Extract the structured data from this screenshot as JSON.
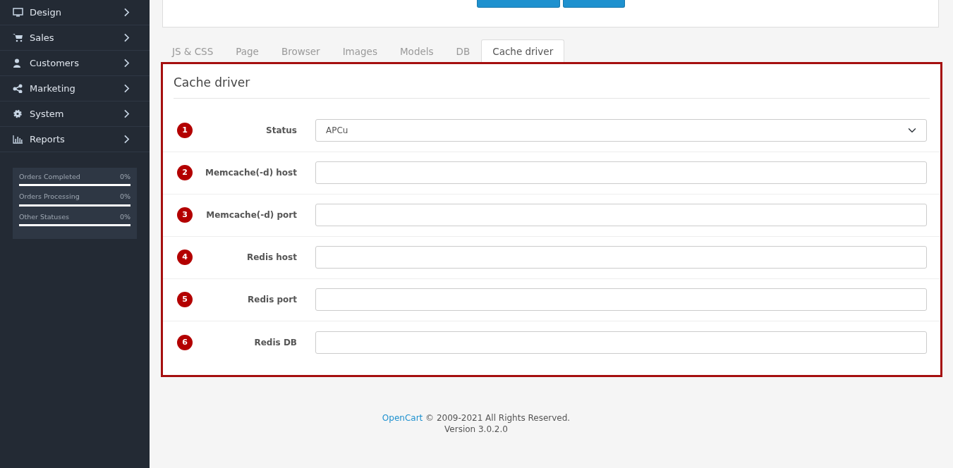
{
  "sidebar": {
    "menu": [
      {
        "label": "Design"
      },
      {
        "label": "Sales"
      },
      {
        "label": "Customers"
      },
      {
        "label": "Marketing"
      },
      {
        "label": "System"
      },
      {
        "label": "Reports"
      }
    ],
    "stats": [
      {
        "label": "Orders Completed",
        "value": "0%"
      },
      {
        "label": "Orders Processing",
        "value": "0%"
      },
      {
        "label": "Other Statuses",
        "value": "0%"
      }
    ]
  },
  "tabs": [
    {
      "label": "JS & CSS",
      "selected": false
    },
    {
      "label": "Page",
      "selected": false
    },
    {
      "label": "Browser",
      "selected": false
    },
    {
      "label": "Images",
      "selected": false
    },
    {
      "label": "Models",
      "selected": false
    },
    {
      "label": "DB",
      "selected": false
    },
    {
      "label": "Cache driver",
      "selected": true
    }
  ],
  "panel": {
    "title": "Cache driver",
    "fields": [
      {
        "number": "1",
        "label": "Status",
        "kind": "select",
        "value": "APCu"
      },
      {
        "number": "2",
        "label": "Memcache(-d) host",
        "kind": "text"
      },
      {
        "number": "3",
        "label": "Memcache(-d) port",
        "kind": "text"
      },
      {
        "number": "4",
        "label": "Redis host",
        "kind": "text"
      },
      {
        "number": "5",
        "label": "Redis port",
        "kind": "text"
      },
      {
        "number": "6",
        "label": "Redis DB",
        "kind": "text"
      }
    ]
  },
  "footer": {
    "link": "OpenCart",
    "text": "© 2009-2021 All Rights Reserved.",
    "version": "Version 3.0.2.0"
  }
}
